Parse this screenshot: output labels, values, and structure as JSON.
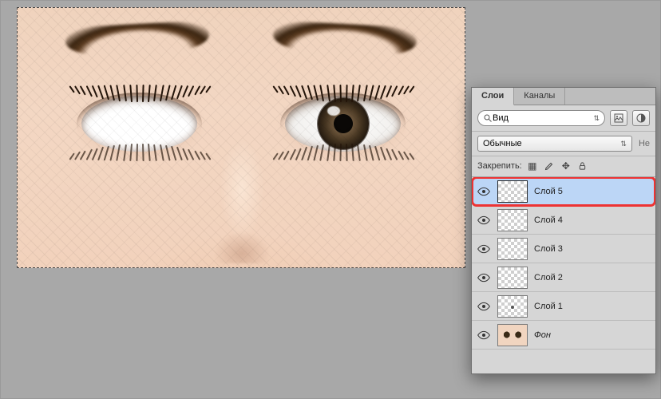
{
  "panel": {
    "tabs": [
      {
        "label": "Слои",
        "active": true
      },
      {
        "label": "Каналы",
        "active": false
      }
    ],
    "search": {
      "mode_label": "Вид"
    },
    "blend": {
      "mode_label": "Обычные",
      "opacity_hint": "Не"
    },
    "lock": {
      "label": "Закрепить:"
    },
    "layers": [
      {
        "name": "Слой 5",
        "thumb": "checker",
        "italic": false,
        "active": true,
        "highlight": true
      },
      {
        "name": "Слой 4",
        "thumb": "checker",
        "italic": false,
        "active": false,
        "highlight": false
      },
      {
        "name": "Слой 3",
        "thumb": "checker",
        "italic": false,
        "active": false,
        "highlight": false
      },
      {
        "name": "Слой 2",
        "thumb": "checker",
        "italic": false,
        "active": false,
        "highlight": false
      },
      {
        "name": "Слой 1",
        "thumb": "checker-dot",
        "italic": false,
        "active": false,
        "highlight": false
      },
      {
        "name": "Фон",
        "thumb": "eyes",
        "italic": true,
        "active": false,
        "highlight": false
      }
    ]
  }
}
